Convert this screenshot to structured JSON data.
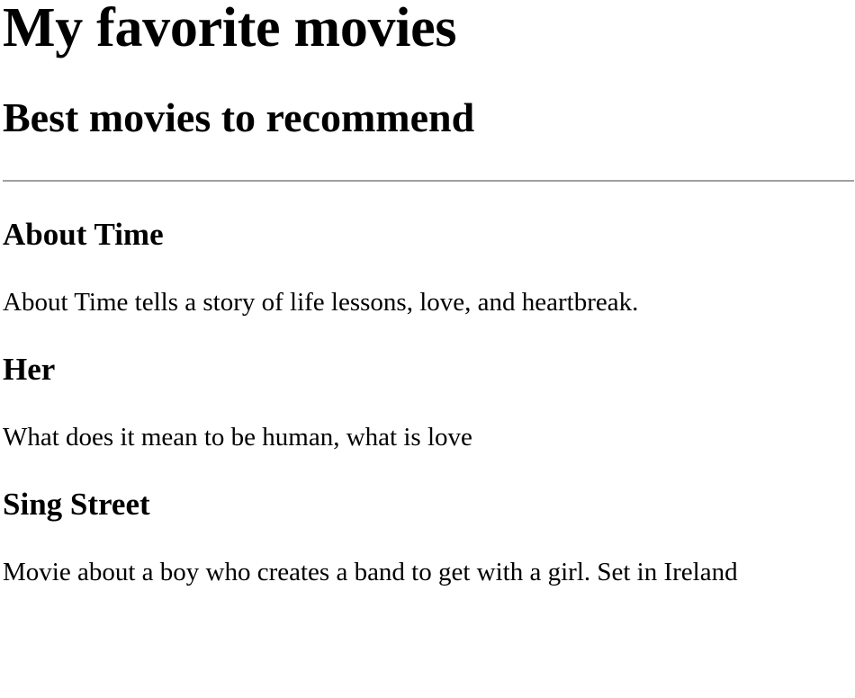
{
  "page": {
    "title": "My favorite movies",
    "subtitle": "Best movies to recommend"
  },
  "movies": [
    {
      "title": "About Time",
      "description": "About Time tells a story of life lessons, love, and heartbreak."
    },
    {
      "title": "Her",
      "description": "What does it mean to be human, what is love"
    },
    {
      "title": "Sing Street",
      "description": "Movie about a boy who creates a band to get with a girl. Set in Ireland"
    }
  ]
}
